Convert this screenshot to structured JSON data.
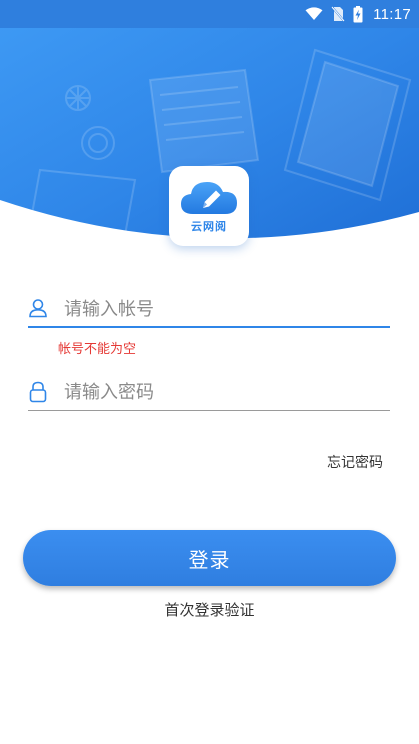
{
  "status_bar": {
    "time": "11:17",
    "icons": [
      "wifi-icon",
      "no-sim-icon",
      "battery-charging-icon"
    ]
  },
  "app": {
    "logo_text": "云网阅",
    "logo_icon": "cloud-pencil-icon"
  },
  "login_form": {
    "username_placeholder": "请输入帐号",
    "username_value": "",
    "username_icon": "user-icon",
    "username_error": "帐号不能为空",
    "password_placeholder": "请输入密码",
    "password_value": "",
    "password_icon": "lock-icon",
    "forgot_password": "忘记密码",
    "login_button": "登录",
    "first_login_verify": "首次登录验证"
  },
  "colors": {
    "primary": "#2f86e8",
    "header": "#2f7fde",
    "error": "#e53935",
    "text": "#333333",
    "placeholder": "#8a8a8a"
  }
}
